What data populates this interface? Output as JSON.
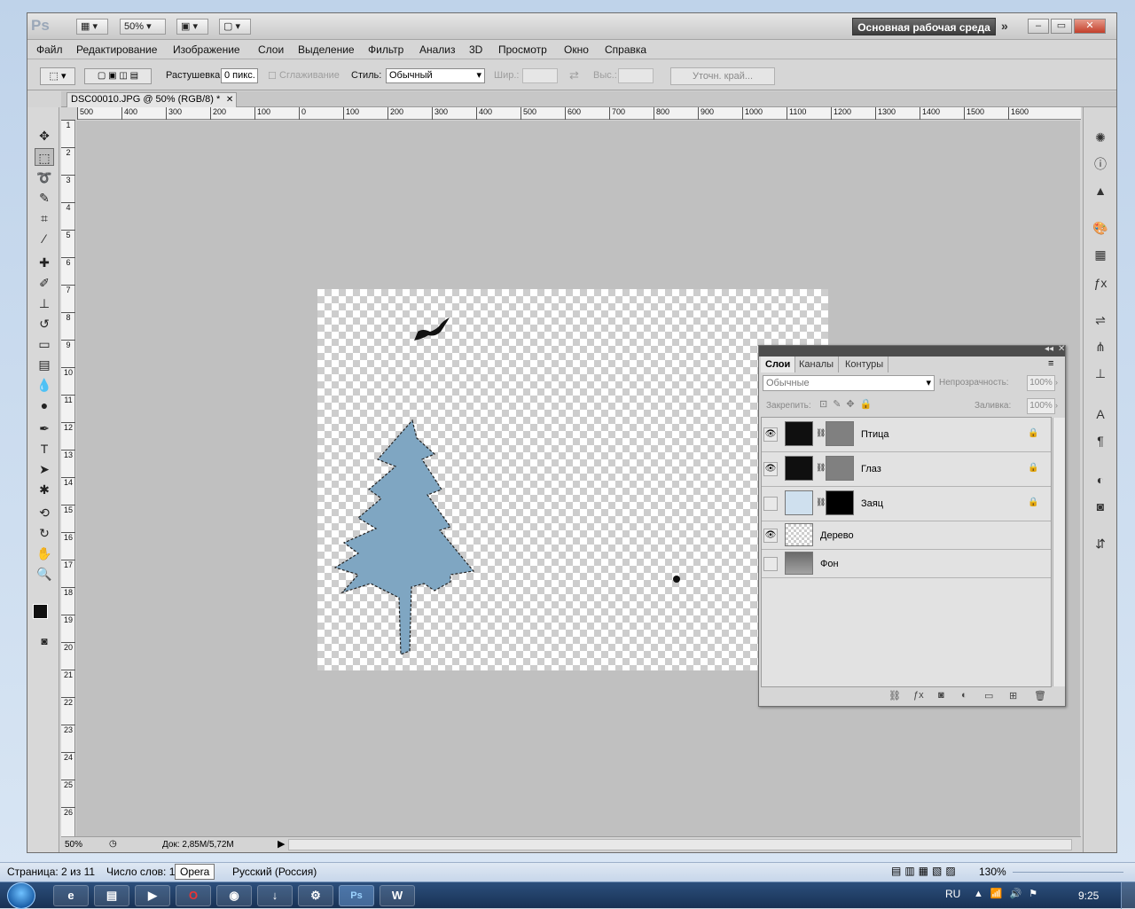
{
  "photoshop": {
    "logo": "Ps",
    "zoom": "50%",
    "workspace_label": "Основная рабочая среда",
    "menu": [
      "Файл",
      "Редактирование",
      "Изображение",
      "Слои",
      "Выделение",
      "Фильтр",
      "Анализ",
      "3D",
      "Просмотр",
      "Окно",
      "Справка"
    ],
    "options": {
      "feather_label": "Растушевка:",
      "feather_value": "0 пикс.",
      "antialias_label": "Сглаживание",
      "style_label": "Стиль:",
      "style_value": "Обычный",
      "width_label": "Шир.:",
      "height_label": "Выс.:",
      "refine_edge_label": "Уточн. край..."
    },
    "document_tab": "DSC00010.JPG @ 50% (RGB/8) *",
    "ruler_top": [
      "500",
      "400",
      "300",
      "200",
      "100",
      "0",
      "100",
      "200",
      "300",
      "400",
      "500",
      "600",
      "700",
      "800",
      "900",
      "1000",
      "1100",
      "1200",
      "1300",
      "1400",
      "1500",
      "1600"
    ],
    "ruler_left": [
      "1",
      "2",
      "3",
      "4",
      "5",
      "6",
      "7",
      "8",
      "9",
      "10",
      "11",
      "12",
      "13",
      "14",
      "15",
      "16",
      "17",
      "18",
      "19",
      "20",
      "21",
      "22",
      "23",
      "24",
      "25",
      "26"
    ],
    "status": {
      "zoom": "50%",
      "doc_info": "Док: 2,85M/5,72M"
    }
  },
  "layers_panel": {
    "tabs": [
      "Слои",
      "Каналы",
      "Контуры"
    ],
    "blend_mode": "Обычные",
    "opacity_label": "Непрозрачность:",
    "opacity_value": "100%",
    "lock_label": "Закрепить:",
    "fill_label": "Заливка:",
    "fill_value": "100%",
    "layers": [
      {
        "name": "Птица",
        "visible": true,
        "locked": true
      },
      {
        "name": "Глаз",
        "visible": true,
        "locked": true
      },
      {
        "name": "Заяц",
        "visible": false,
        "locked": true
      },
      {
        "name": "Дерево",
        "visible": true,
        "locked": false
      },
      {
        "name": "Фон",
        "visible": false,
        "locked": false
      }
    ]
  },
  "word_status": {
    "page": "Страница: 2 из 11",
    "words": "Число слов: 1 6",
    "language": "Русский (Россия)",
    "zoom": "130%"
  },
  "tooltip": "Opera",
  "taskbar": {
    "lang": "RU",
    "clock": "9:25"
  },
  "colors": {
    "tree": "#7fa6c2",
    "canvas_bg": "#c0c0c0",
    "workspace_btn": "#4a4a4a"
  }
}
